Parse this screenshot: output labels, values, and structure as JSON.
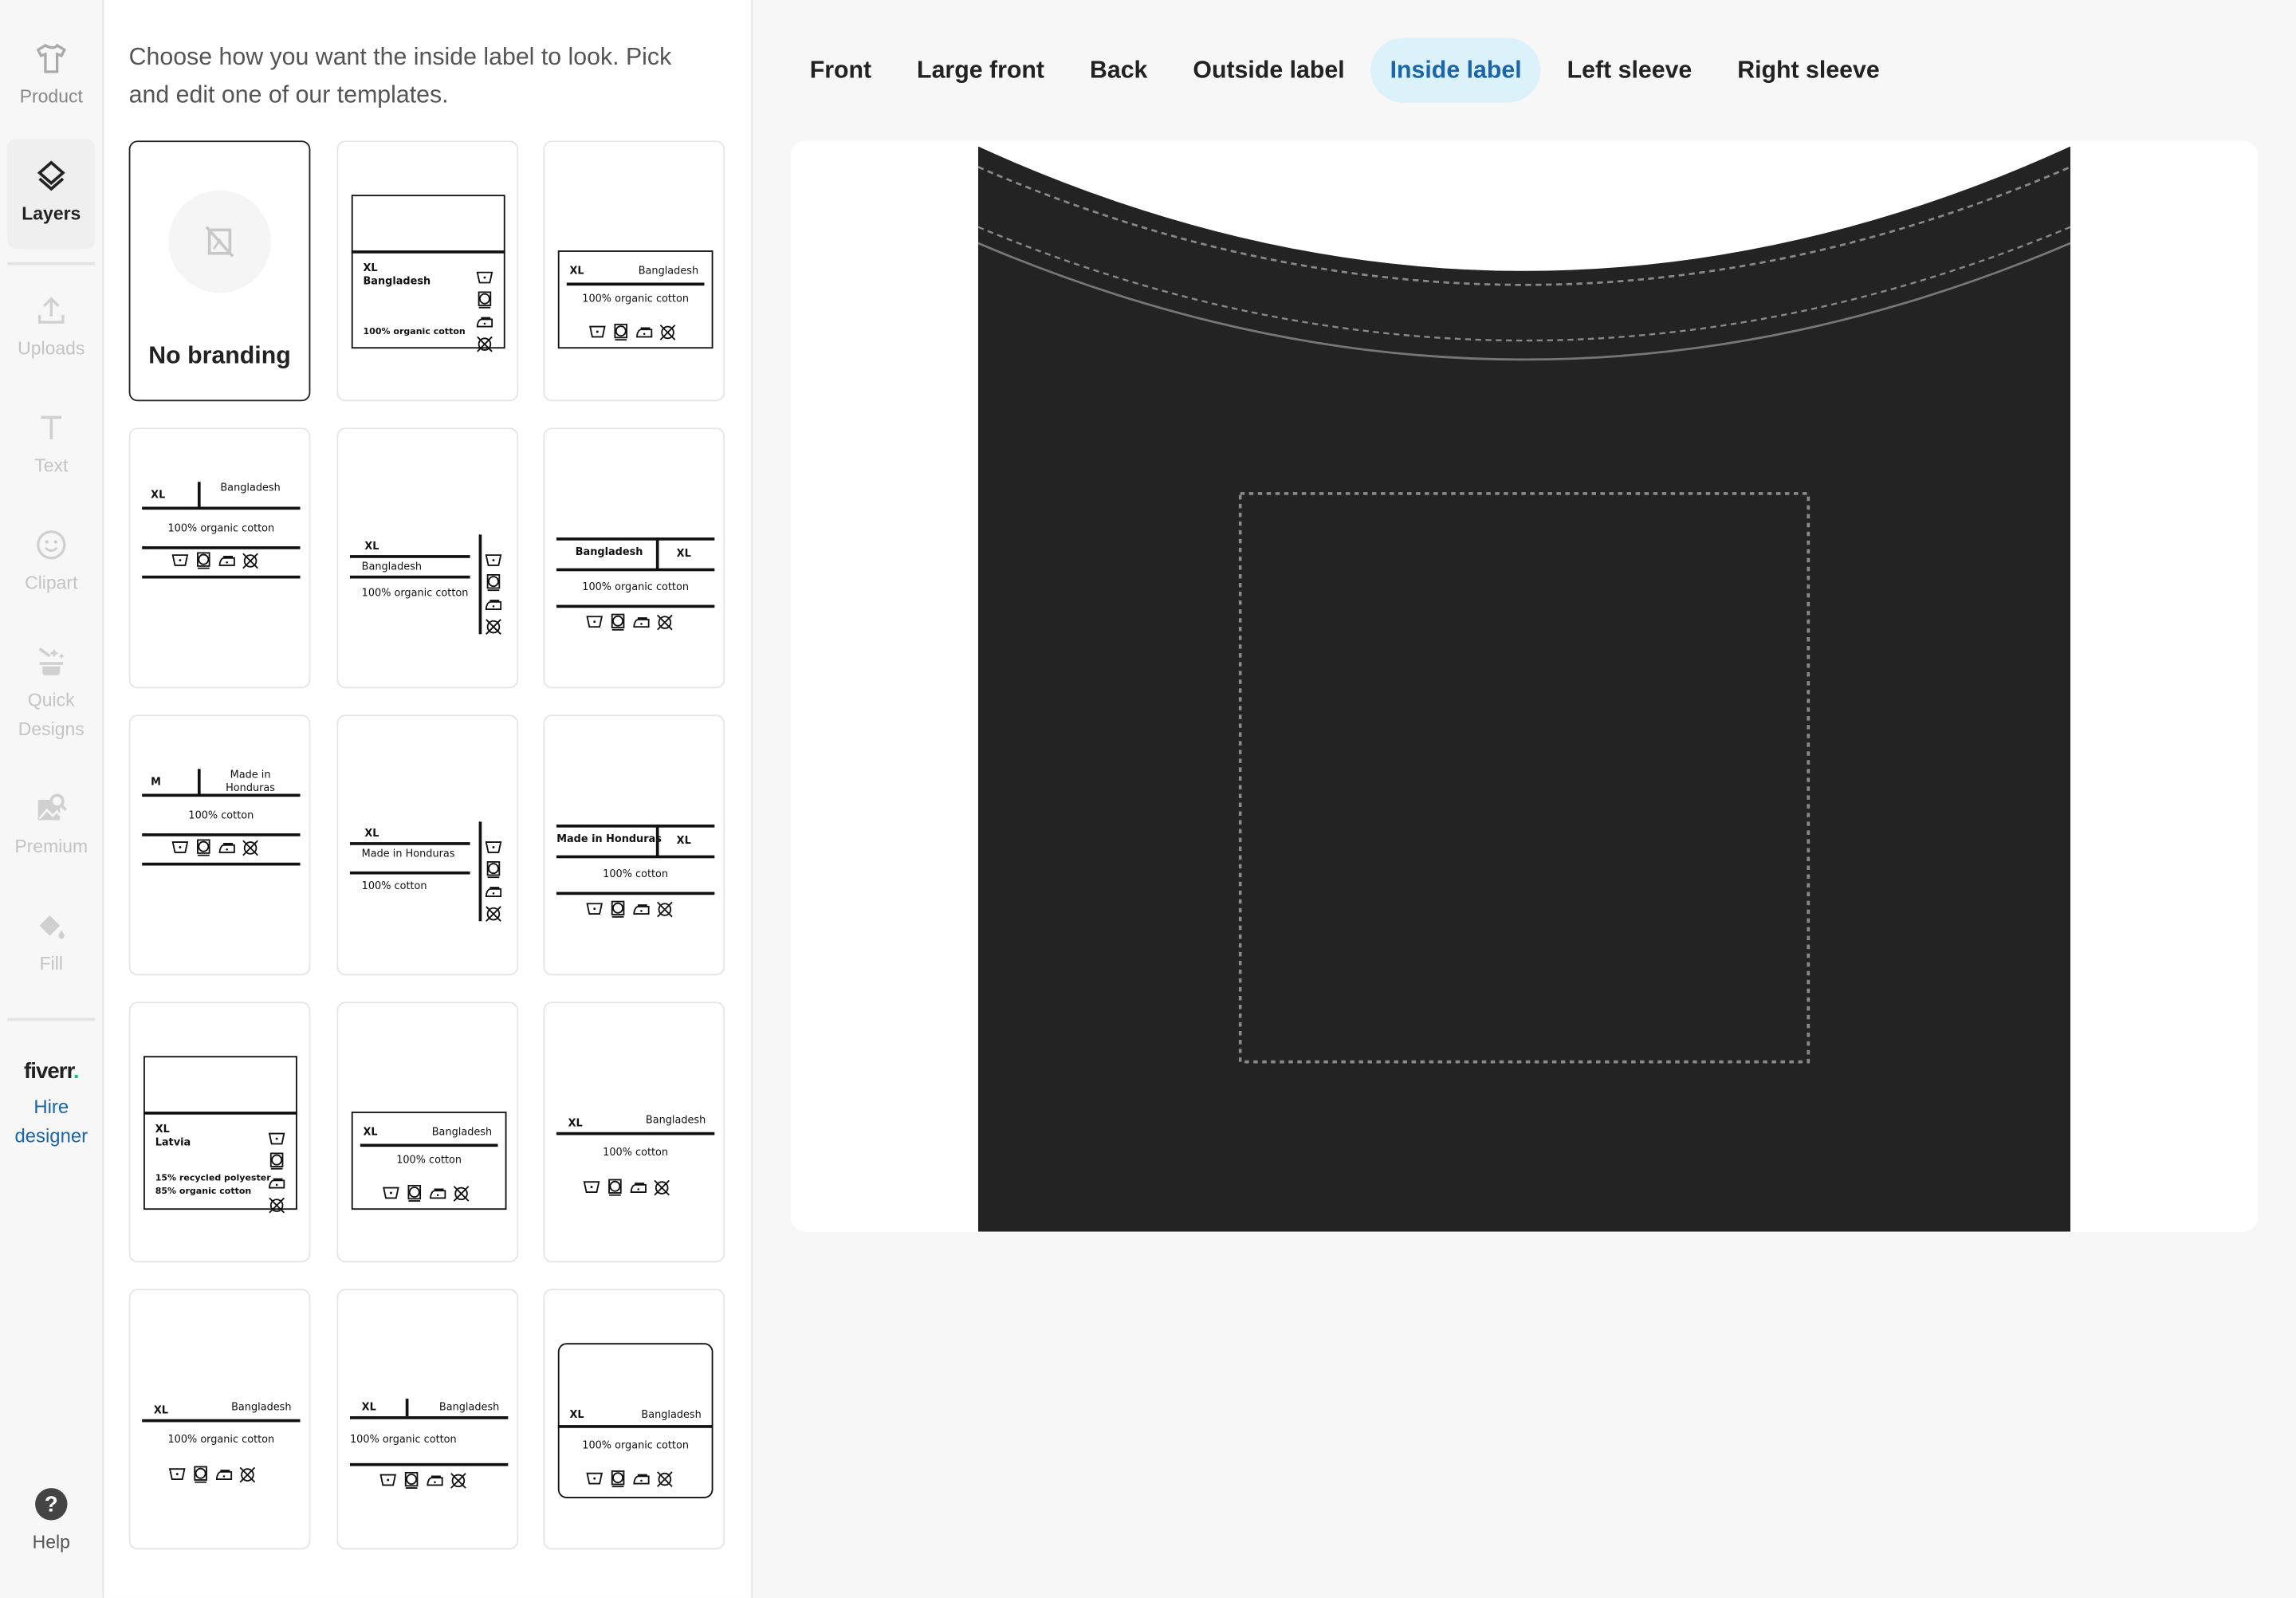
{
  "sidebar": {
    "items": [
      {
        "label": "Product",
        "icon": "tshirt-icon",
        "state": "normal"
      },
      {
        "label": "Layers",
        "icon": "layers-icon",
        "state": "active"
      },
      {
        "label": "Uploads",
        "icon": "upload-icon",
        "state": "dim"
      },
      {
        "label": "Text",
        "icon": "text-icon",
        "state": "dim"
      },
      {
        "label": "Clipart",
        "icon": "smiley-icon",
        "state": "dim"
      },
      {
        "label": "Quick Designs",
        "icon": "magic-wand-icon",
        "state": "dim"
      },
      {
        "label": "Premium",
        "icon": "premium-image-icon",
        "state": "dim"
      },
      {
        "label": "Fill",
        "icon": "paint-bucket-icon",
        "state": "dim"
      }
    ],
    "fiverr_logo": "fiverr.",
    "hire_label": "Hire designer",
    "help_label": "Help",
    "accent": "#1a66a8",
    "fiverr_green": "#1dbf73"
  },
  "panel": {
    "intro": "Choose how you want the inside label to look. Pick and edit one of our templates.",
    "no_branding": "No branding",
    "templates": [
      {
        "style": "boxed",
        "size": "XL",
        "origin": "Bangladesh",
        "material": [
          "100% organic cotton"
        ]
      },
      {
        "style": "bracket",
        "size": "XL",
        "origin": "Bangladesh",
        "material": [
          "100% organic cotton"
        ]
      },
      {
        "style": "split",
        "size": "XL",
        "origin": "Bangladesh",
        "material": [
          "100% organic cotton"
        ]
      },
      {
        "style": "side",
        "size": "XL",
        "origin": "Bangladesh",
        "material": [
          "100% organic cotton"
        ]
      },
      {
        "style": "split-right",
        "size": "XL",
        "origin": "Bangladesh",
        "material": [
          "100% organic cotton"
        ]
      },
      {
        "style": "split",
        "size": "M",
        "origin": "Made in Honduras",
        "material": [
          "100% cotton"
        ]
      },
      {
        "style": "side",
        "size": "XL",
        "origin": "Made in Honduras",
        "material": [
          "100% cotton"
        ]
      },
      {
        "style": "split-right",
        "size": "XL",
        "origin": "Made in Honduras",
        "material": [
          "100% cotton"
        ]
      },
      {
        "style": "boxed",
        "size": "XL",
        "origin": "Latvia",
        "material": [
          "15% recycled polyester",
          "85% organic cotton"
        ]
      },
      {
        "style": "bracket",
        "size": "XL",
        "origin": "Bangladesh",
        "material": [
          "100% cotton"
        ]
      },
      {
        "style": "line",
        "size": "XL",
        "origin": "Bangladesh",
        "material": [
          "100% cotton"
        ]
      },
      {
        "style": "line",
        "size": "XL",
        "origin": "Bangladesh",
        "material": [
          "100% organic cotton"
        ]
      },
      {
        "style": "split-line",
        "size": "XL",
        "origin": "Bangladesh",
        "material": [
          "100% organic cotton"
        ]
      },
      {
        "style": "rounded",
        "size": "XL",
        "origin": "Bangladesh",
        "material": [
          "100% organic cotton"
        ]
      }
    ],
    "care_icons": [
      "wash-30-icon",
      "tumble-dry-icon",
      "iron-low-icon",
      "no-dry-clean-icon"
    ]
  },
  "tabs": [
    {
      "label": "Front",
      "active": false
    },
    {
      "label": "Large front",
      "active": false
    },
    {
      "label": "Back",
      "active": false
    },
    {
      "label": "Outside label",
      "active": false
    },
    {
      "label": "Inside label",
      "active": true
    },
    {
      "label": "Left sleeve",
      "active": false
    },
    {
      "label": "Right sleeve",
      "active": false
    }
  ],
  "canvas": {
    "shirt_color": "#232323"
  }
}
